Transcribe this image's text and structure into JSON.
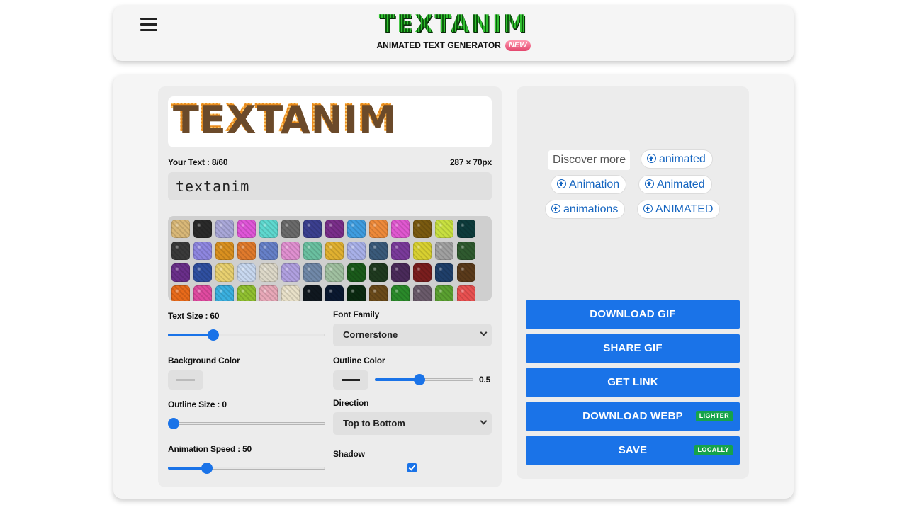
{
  "header": {
    "logo": "TEXTANIM",
    "tagline": "ANIMATED TEXT GENERATOR",
    "badge": "NEW",
    "menu_icon": "hamburger-menu-icon"
  },
  "editor": {
    "preview_text": "TEXTANIM",
    "your_text_label": "Your Text : 8/60",
    "dimensions": "287 × 70px",
    "text_value": "textanim",
    "text_size": {
      "label": "Text Size : 60",
      "fraction": 0.27
    },
    "font_family": {
      "label": "Font Family",
      "selected": "Cornerstone"
    },
    "background_color": {
      "label": "Background Color",
      "value": "#ffffff"
    },
    "outline_color": {
      "label": "Outline Color",
      "value": "#222222",
      "opacity_value": "0.5",
      "opacity_fraction": 0.45
    },
    "outline_size": {
      "label": "Outline Size : 0",
      "fraction": 0.0
    },
    "direction": {
      "label": "Direction",
      "selected": "Top to Bottom"
    },
    "animation_speed": {
      "label": "Animation Speed : 50",
      "fraction": 0.23
    },
    "shadow": {
      "label": "Shadow",
      "checked": true
    }
  },
  "textures": [
    "#d9b878",
    "#2a2a2a",
    "#a9a7d8",
    "#e055d8",
    "#5ed8cf",
    "#6a6a6a",
    "#3b3f8f",
    "#7a2e8a",
    "#3f9de0",
    "#ee8a3a",
    "#e058d0",
    "#7a5a10",
    "#c8e040",
    "#0d3b3b",
    "#3a3a3a",
    "#8e86e0",
    "#d9901f",
    "#e07a2c",
    "#6680c8",
    "#e090d0",
    "#6ac0a0",
    "#e0b030",
    "#a8b0e8",
    "#3a5a7a",
    "#7a3a9a",
    "#d8d030",
    "#a0a0a0",
    "#2f5a2f",
    "#6a2e8a",
    "#2f4fa0",
    "#e8d070",
    "#c8d8f0",
    "#ddd8c8",
    "#b0a0e0",
    "#7088a8",
    "#a0c0a0",
    "#1a5a1a",
    "#1f3a1f",
    "#4a2a5a",
    "#7a1e1e",
    "#1f3f6a",
    "#5a3a1a",
    "#e86a1a",
    "#e04aa0",
    "#3ab0e0",
    "#90c030",
    "#e8a8b8",
    "#e8e0c8",
    "#101820",
    "#0a1830",
    "#0a2a10",
    "#6a4a1a",
    "#2a8a2a",
    "#6a5a6a",
    "#5aa030",
    "#e85050"
  ],
  "sidebar": {
    "discover_label": "Discover more",
    "chips": [
      "animated",
      "Animation",
      "Animated",
      "animations",
      "ANIMATED"
    ],
    "chip_icon": "search-arrow-icon"
  },
  "actions": {
    "download_gif": "DOWNLOAD GIF",
    "share_gif": "SHARE GIF",
    "get_link": "GET LINK",
    "download_webp": "DOWNLOAD WEBP",
    "webp_tag": "LIGHTER",
    "save": "SAVE",
    "save_tag": "LOCALLY"
  },
  "colors": {
    "accent": "#1a73e8",
    "tag_green": "#16a34a",
    "chip_blue": "#1565c0"
  }
}
